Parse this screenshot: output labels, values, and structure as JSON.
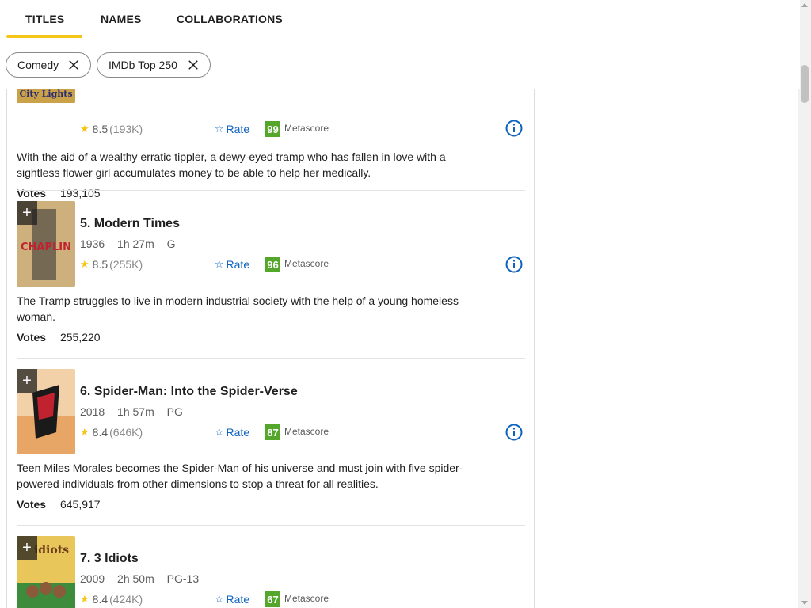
{
  "tabs": {
    "titles": "TITLES",
    "names": "NAMES",
    "collaborations": "COLLABORATIONS"
  },
  "chips": {
    "comedy": "Comedy",
    "imdb_top": "IMDb Top 250"
  },
  "colors": {
    "accent": "#f5c518",
    "link": "#0e63be",
    "metascore_green": "#54a72a"
  },
  "movies": [
    {
      "title": "",
      "rating": "8.5",
      "votes_short": "(193K)",
      "rate_label": "Rate",
      "metascore": "99",
      "metascore_label": "Metascore",
      "plot": "With the aid of a wealthy erratic tippler, a dewy-eyed tramp who has fallen in love with a sightless flower girl accumulates money to be able to help her medically.",
      "votes_label": "Votes",
      "votes": "193,105",
      "poster_text": "City Lights"
    },
    {
      "title": "5. Modern Times",
      "year": "1936",
      "runtime": "1h 27m",
      "cert": "G",
      "rating": "8.5",
      "votes_short": "(255K)",
      "rate_label": "Rate",
      "metascore": "96",
      "metascore_label": "Metascore",
      "plot": "The Tramp struggles to live in modern industrial society with the help of a young homeless woman.",
      "votes_label": "Votes",
      "votes": "255,220",
      "poster_text": "CHAPLIN"
    },
    {
      "title": "6. Spider-Man: Into the Spider-Verse",
      "year": "2018",
      "runtime": "1h 57m",
      "cert": "PG",
      "rating": "8.4",
      "votes_short": "(646K)",
      "rate_label": "Rate",
      "metascore": "87",
      "metascore_label": "Metascore",
      "plot": "Teen Miles Morales becomes the Spider-Man of his universe and must join with five spider-powered individuals from other dimensions to stop a threat for all realities.",
      "votes_label": "Votes",
      "votes": "645,917"
    },
    {
      "title": "7. 3 Idiots",
      "year": "2009",
      "runtime": "2h 50m",
      "cert": "PG-13",
      "rating": "8.4",
      "votes_short": "(424K)",
      "rate_label": "Rate",
      "metascore": "67",
      "metascore_label": "Metascore",
      "poster_text": "idiots"
    }
  ]
}
